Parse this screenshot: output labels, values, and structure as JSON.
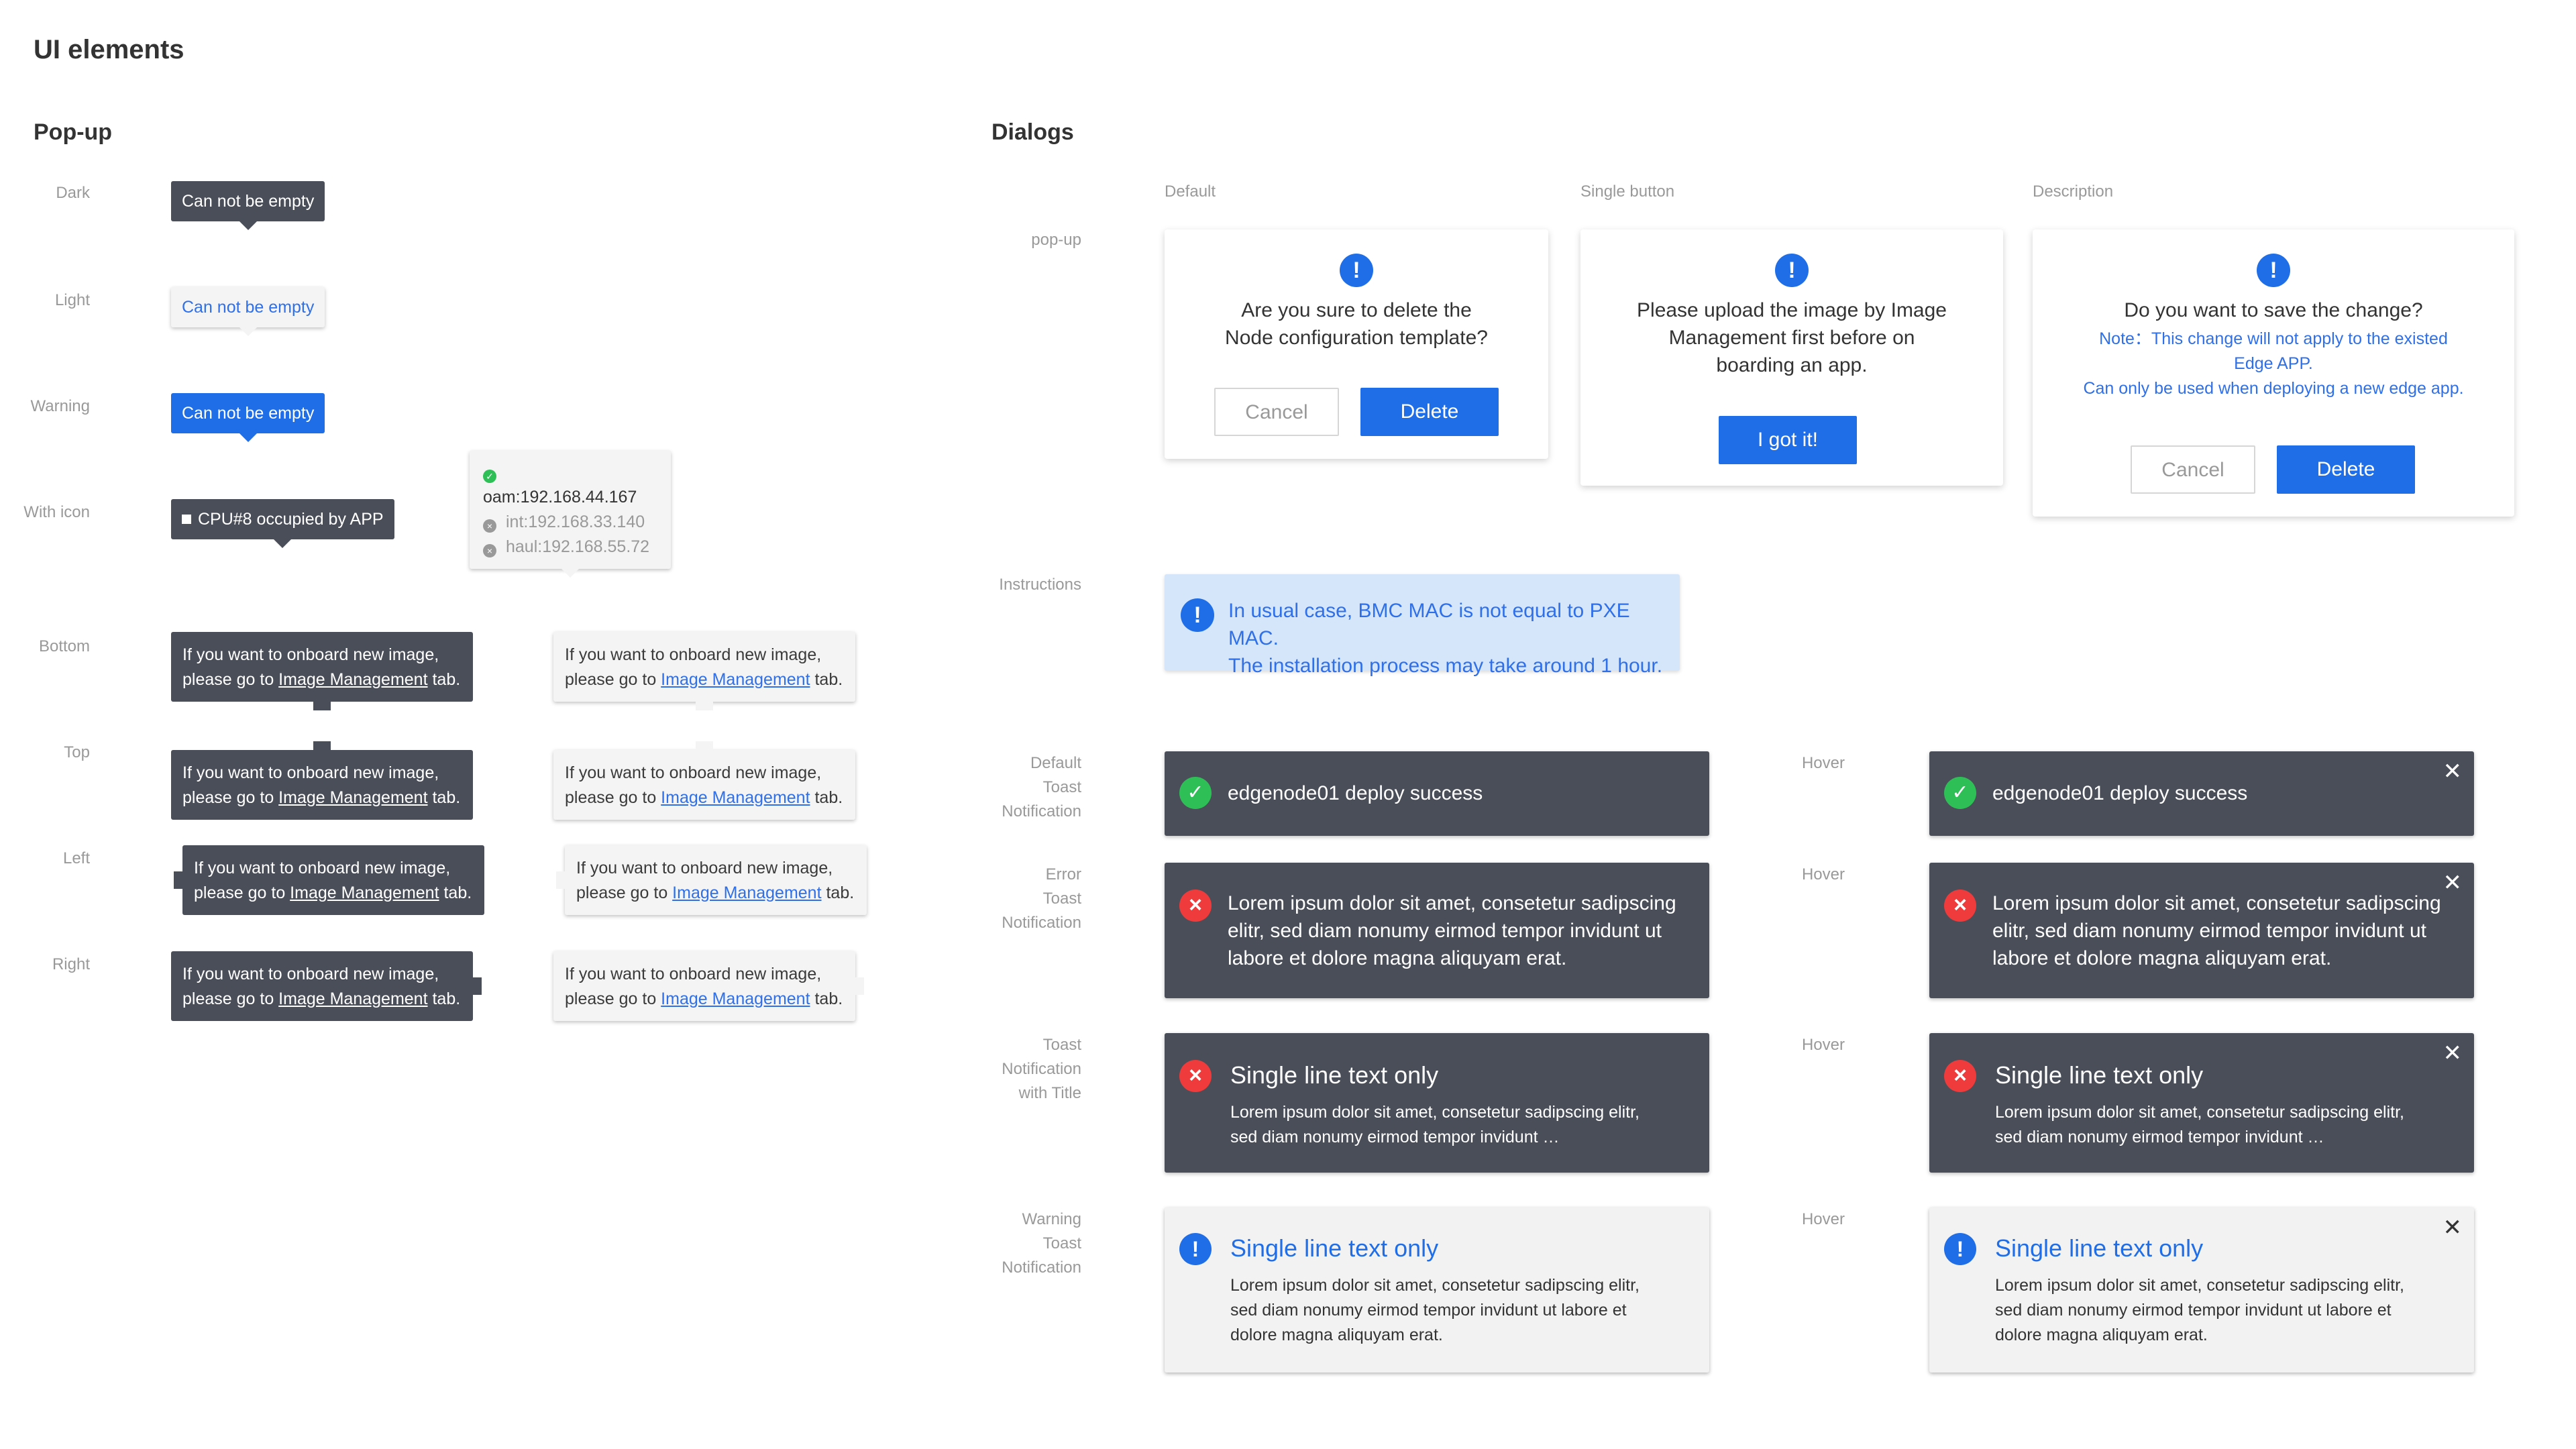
{
  "page_title": "UI elements",
  "popup": {
    "title": "Pop-up",
    "row_labels": {
      "dark": "Dark",
      "light": "Light",
      "warning": "Warning",
      "with_icon": "With icon",
      "bottom": "Bottom",
      "top": "Top",
      "left": "Left",
      "right": "Right"
    },
    "simple_text": "Can not be empty",
    "icon_tip_text": "CPU#8 occupied by APP",
    "ip_list": [
      "oam:192.168.44.167",
      "int:192.168.33.140",
      "haul:192.168.55.72"
    ],
    "multi_line1": "If you want to onboard new image,",
    "multi_line2_prefix": "please go to ",
    "multi_link": "Image Management",
    "multi_line2_suffix": " tab."
  },
  "dialogs": {
    "title": "Dialogs",
    "col_labels": {
      "default": "Default",
      "single": "Single button",
      "description": "Description"
    },
    "row_labels": {
      "popup": "pop-up",
      "instructions": "Instructions"
    },
    "default": {
      "line1": "Are you sure to delete the",
      "line2": "Node configuration template?",
      "cancel": "Cancel",
      "confirm": "Delete"
    },
    "single": {
      "line1": "Please upload the image by Image",
      "line2": "Management first before on",
      "line3": "boarding an app.",
      "button": "I got it!"
    },
    "description": {
      "question": "Do you want to save the change?",
      "note1": "Note：This change will not apply to the existed",
      "note2": "Edge APP.",
      "note3": "Can only be used when deploying a new edge app.",
      "cancel": "Cancel",
      "confirm": "Delete"
    },
    "instructions": {
      "line1": "In usual case, BMC MAC is not equal to PXE MAC.",
      "line2": "The installation process may take around 1 hour."
    }
  },
  "toasts": {
    "labels": {
      "default": [
        "Default",
        "Toast",
        "Notification"
      ],
      "error": [
        "Error",
        "Toast",
        "Notification"
      ],
      "title": [
        "Toast",
        "Notification",
        "with Title"
      ],
      "warning": [
        "Warning",
        "Toast",
        "Notification"
      ],
      "hover": "Hover"
    },
    "success_text": "edgenode01 deploy success",
    "error_lines": [
      "Lorem ipsum dolor sit amet, consetetur sadipscing",
      "elitr, sed diam nonumy eirmod tempor invidunt ut",
      "labore et dolore magna aliquyam erat."
    ],
    "title_text": "Single line text only",
    "title_body": [
      "Lorem ipsum dolor sit amet, consetetur sadipscing elitr,",
      "sed diam nonumy eirmod tempor invidunt …"
    ],
    "warn_body": [
      "Lorem ipsum dolor sit amet, consetetur sadipscing elitr,",
      "sed diam nonumy eirmod tempor invidunt ut labore et",
      "dolore magna aliquyam erat."
    ]
  },
  "icons": {
    "info": "info-icon",
    "success": "check-circle-icon",
    "error": "error-x-icon",
    "close": "close-icon",
    "square": "square-icon"
  },
  "colors": {
    "primary": "#1f6ee8",
    "dark_bg": "#4a4e58",
    "success": "#2fbf57",
    "error": "#ef3b3b",
    "info_bg": "#d5e6fb"
  }
}
